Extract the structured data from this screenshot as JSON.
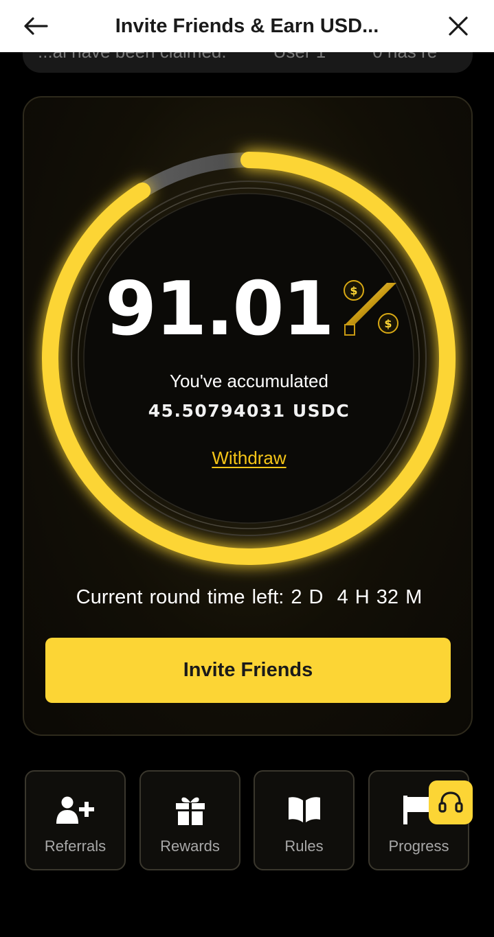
{
  "header": {
    "title": "Invite Friends & Earn USD...",
    "back_icon": "arrow-left-icon",
    "close_icon": "close-icon"
  },
  "ticker": {
    "items": [
      "...al have been claimed.",
      "User 1",
      "0 has re"
    ]
  },
  "progress": {
    "value": "91.01",
    "percent_fill": 91.01,
    "percent_icon": "percent-coins-icon",
    "accumulated_label": "You've accumulated",
    "accumulated_amount": "45.50794031 USDC",
    "withdraw_label": "Withdraw"
  },
  "timer": {
    "label": "Current round time left:",
    "value": "2 D  4 H 32 M"
  },
  "invite_button": "Invite Friends",
  "tiles": [
    {
      "label": "Referrals",
      "icon": "add-user-icon"
    },
    {
      "label": "Rewards",
      "icon": "gift-icon"
    },
    {
      "label": "Rules",
      "icon": "book-icon"
    },
    {
      "label": "Progress",
      "icon": "flag-icon"
    }
  ],
  "support_icon": "headset-icon",
  "colors": {
    "accent": "#fcd535",
    "withdraw": "#f5c518",
    "background": "#000000",
    "card": "#120f06"
  }
}
